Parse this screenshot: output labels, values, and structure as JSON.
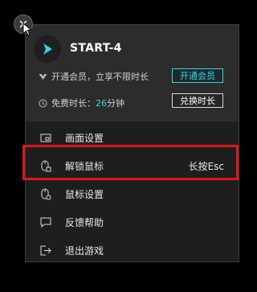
{
  "game": {
    "title": "START-4"
  },
  "vip": {
    "promo_text": "开通会员，立享不限时长",
    "button_label": "开通会员"
  },
  "time": {
    "label": "免费时长：",
    "value": "26",
    "unit": "分钟",
    "button_label": "兑换时长"
  },
  "menu": {
    "items": [
      {
        "label": "画面设置",
        "icon": "screen-icon",
        "shortcut": ""
      },
      {
        "label": "解锁鼠标",
        "icon": "mouse-lock-icon",
        "shortcut": "长按Esc"
      },
      {
        "label": "鼠标设置",
        "icon": "mouse-settings-icon",
        "shortcut": ""
      },
      {
        "label": "反馈帮助",
        "icon": "feedback-icon",
        "shortcut": ""
      },
      {
        "label": "退出游戏",
        "icon": "exit-icon",
        "shortcut": ""
      }
    ]
  },
  "colors": {
    "accent": "#36d3e6",
    "highlight": "#e0141e"
  }
}
